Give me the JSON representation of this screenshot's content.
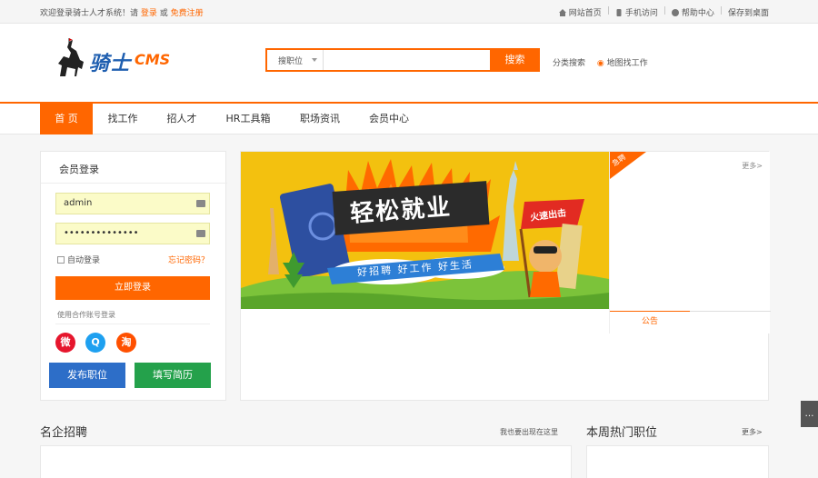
{
  "topbar": {
    "welcome": "欢迎登录骑士人才系统！请",
    "login_link": "登录",
    "or": "或",
    "register_link": "免费注册",
    "links": [
      {
        "icon": "home-icon",
        "label": "网站首页"
      },
      {
        "icon": "mobile-icon",
        "label": "手机访问"
      },
      {
        "icon": "help-icon",
        "label": "帮助中心"
      },
      {
        "icon": "",
        "label": "保存到桌面"
      }
    ]
  },
  "header": {
    "logo_text": "骑士",
    "logo_cms": "CMS",
    "search_select": "搜职位",
    "search_placeholder": "",
    "search_button": "搜索",
    "category_search": "分类搜索",
    "map_search": "地图找工作"
  },
  "nav": {
    "items": [
      "首 页",
      "找工作",
      "招人才",
      "HR工具箱",
      "职场资讯",
      "会员中心"
    ]
  },
  "login": {
    "title": "会员登录",
    "username": "admin",
    "password": "••••••••••••••",
    "remember": "自动登录",
    "forgot": "忘记密码？",
    "submit": "立即登录",
    "partner_login": "使用合作账号登录",
    "social": [
      {
        "icon": "weibo-icon",
        "glyph": "微",
        "color": "#e6162d"
      },
      {
        "icon": "qq-icon",
        "glyph": "Q",
        "color": "#1ea0f0"
      },
      {
        "icon": "taobao-icon",
        "glyph": "淘",
        "color": "#ff5000"
      }
    ],
    "publish_button": "发布职位",
    "resume_button": "填写简历"
  },
  "banner": {
    "headline": "轻松就业",
    "subline": "好招聘 好工作 好生活",
    "flag_text": "火速出击",
    "colors": {
      "bg": "#f3c10f",
      "orange": "#ff6600",
      "blue": "#2d7fd6"
    }
  },
  "side": {
    "tag": "急聘",
    "more": "更多>",
    "notice_tab": "公告"
  },
  "sections": {
    "famous_title": "名企招聘",
    "famous_link": "我也要出现在这里",
    "hot_title": "本周热门职位",
    "hot_link": "更多>"
  },
  "float_button": "…"
}
